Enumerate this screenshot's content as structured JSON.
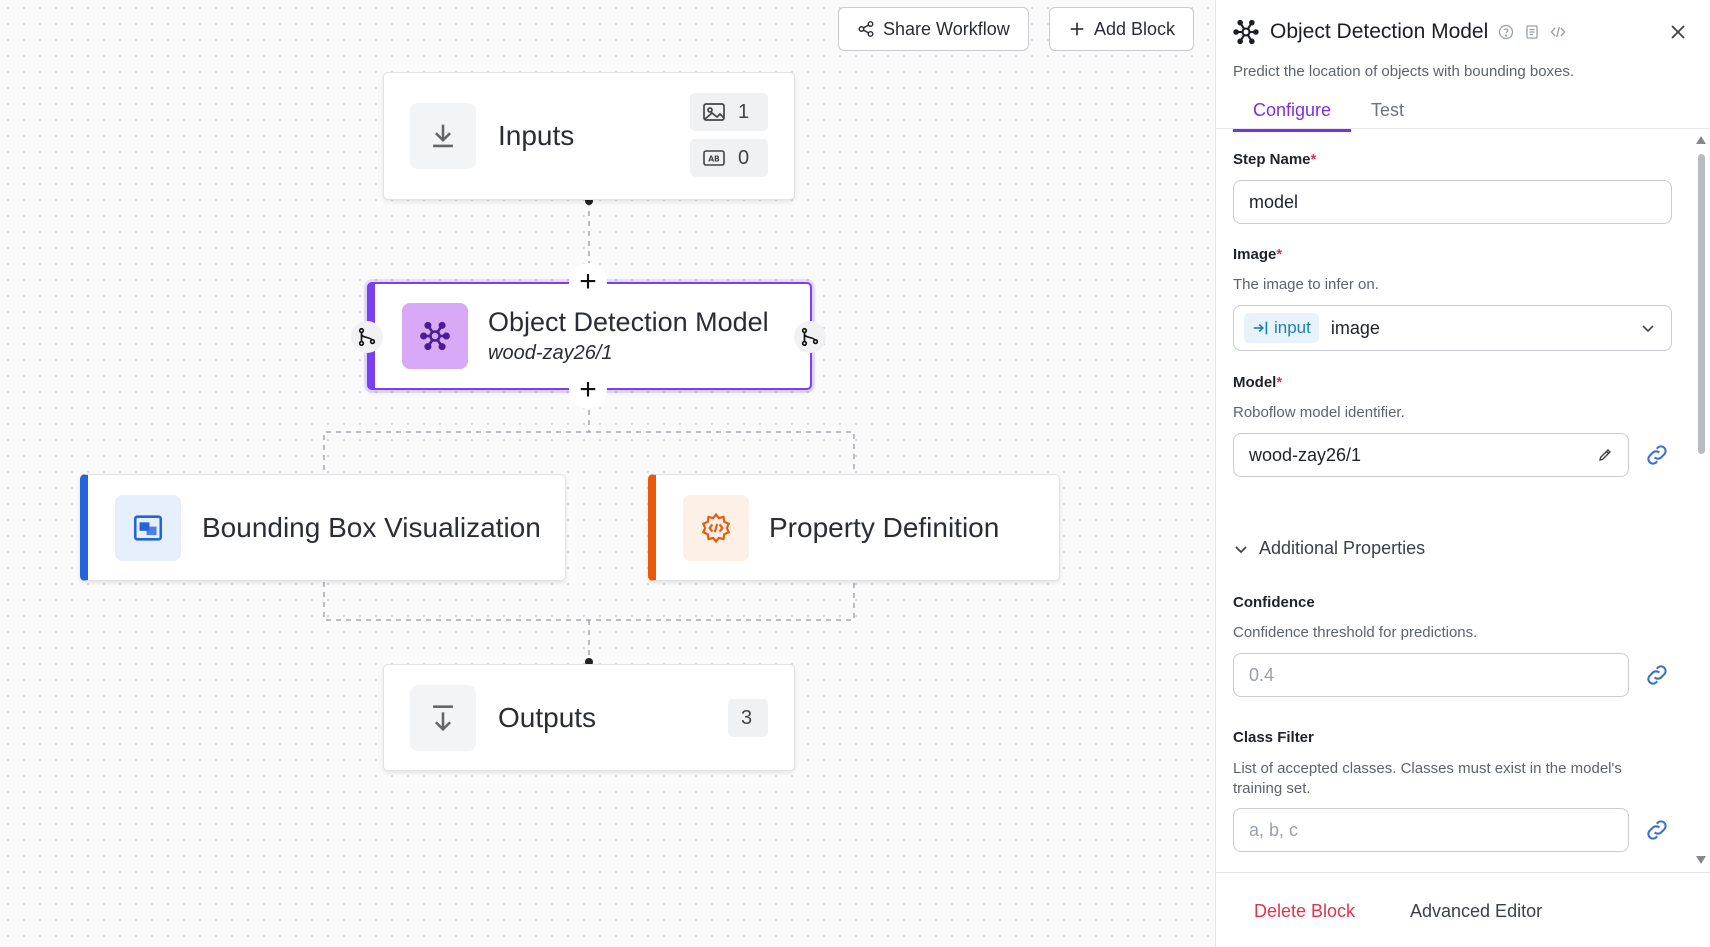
{
  "toolbar": {
    "share_label": "Share Workflow",
    "add_label": "Add Block"
  },
  "nodes": {
    "inputs": {
      "title": "Inputs",
      "image_count": "1",
      "param_count": "0"
    },
    "model": {
      "title": "Object Detection Model",
      "subtitle": "wood-zay26/1"
    },
    "bbox_viz": {
      "title": "Bounding Box Visualization"
    },
    "property_def": {
      "title": "Property Definition"
    },
    "outputs": {
      "title": "Outputs",
      "count": "3"
    }
  },
  "colors": {
    "accent": "#7b2fe0",
    "model_bar": "#7a3ff2",
    "viz_bar": "#2563d9",
    "property_bar": "#e8590c",
    "danger": "#e0334e",
    "link": "#3a72c9"
  },
  "panel": {
    "title": "Object Detection Model",
    "description": "Predict the location of objects with bounding boxes.",
    "tabs": [
      "Configure",
      "Test"
    ],
    "active_tab": "Configure",
    "step_name": {
      "label": "Step Name",
      "required": "*",
      "value": "model"
    },
    "image": {
      "label": "Image",
      "required": "*",
      "description": "The image to infer on.",
      "chip": "input",
      "value": "image"
    },
    "model": {
      "label": "Model",
      "required": "*",
      "description": "Roboflow model identifier.",
      "value": "wood-zay26/1"
    },
    "additional_properties": "Additional Properties",
    "confidence": {
      "label": "Confidence",
      "description": "Confidence threshold for predictions.",
      "placeholder": "0.4"
    },
    "class_filter": {
      "label": "Class Filter",
      "description": "List of accepted classes. Classes must exist in the model's training set.",
      "placeholder": "a, b, c"
    },
    "footer": {
      "delete_label": "Delete Block",
      "advanced_label": "Advanced Editor"
    }
  }
}
